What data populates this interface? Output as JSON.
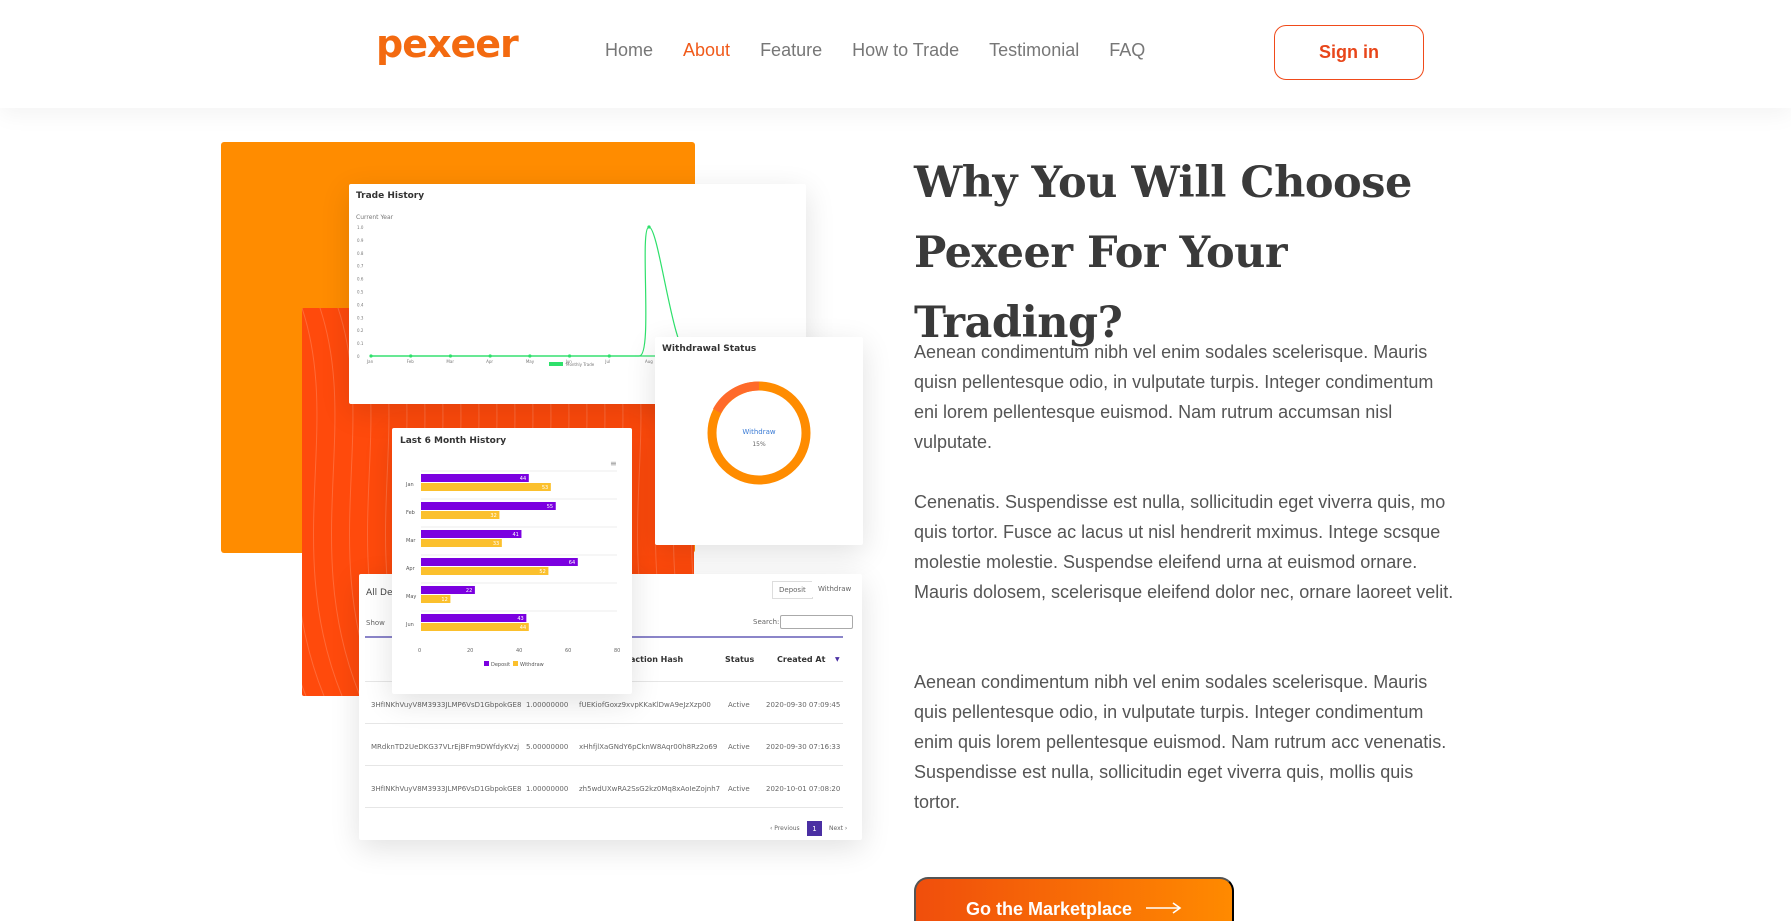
{
  "header": {
    "logo": "pexeer",
    "nav": [
      "Home",
      "About",
      "Feature",
      "How to Trade",
      "Testimonial",
      "FAQ"
    ],
    "active_nav": "About",
    "signin": "Sign in"
  },
  "colors": {
    "brand_orange": "#ff8c00",
    "brand_red": "#ff4a0c",
    "accent_text": "#f05a1a",
    "deposit": "#7b00e0",
    "withdraw": "#fbc02d",
    "chart_line": "#2ee06b"
  },
  "illustration": {
    "trade_history": {
      "title": "Trade History",
      "subtitle": "Current Year",
      "y_ticks": [
        "1.0",
        "0.9",
        "0.8",
        "0.7",
        "0.6",
        "0.5",
        "0.4",
        "0.3",
        "0.2",
        "0.1",
        "0"
      ],
      "x_ticks": [
        "Jan",
        "Feb",
        "Mar",
        "Apr",
        "May",
        "Jun",
        "Jul",
        "Aug"
      ],
      "legend": "Monthly Trade"
    },
    "withdrawal_status": {
      "title": "Withdrawal Status",
      "center_label": "Withdraw",
      "center_value": "15%"
    },
    "last_6_month": {
      "title": "Last 6 Month History",
      "legend": [
        "Deposit",
        "Withdraw"
      ],
      "x_ticks": [
        "0",
        "20",
        "40",
        "60",
        "80"
      ]
    },
    "all_deposits": {
      "title": "All De",
      "tabs": [
        "Deposit",
        "Withdraw"
      ],
      "show_label": "Show",
      "search_label": "Search:",
      "columns": [
        "action Hash",
        "Status",
        "Created At"
      ],
      "rows": [
        {
          "addr": "3HfINKhVuyV8M3933JLMP6VsD1GbpokGE8",
          "amount": "1.00000000",
          "hash": "fUEKiofGoxz9xvpKKaKlDwA9eJzXzp00",
          "status": "Active",
          "created": "2020-09-30 07:09:45"
        },
        {
          "addr": "MRdknTD2UeDKG37VLrEjBFm9DWfdyKVzj",
          "amount": "5.00000000",
          "hash": "xHhfjlXaGNdY6pCknW8Aqr00h8Rz2o69",
          "status": "Active",
          "created": "2020-09-30 07:16:33"
        },
        {
          "addr": "3HfINKhVuyV8M3933JLMP6VsD1GbpokGE8",
          "amount": "1.00000000",
          "hash": "zh5wdUXwRA2SsG2kz0Mq8xAoIeZojnh7",
          "status": "Active",
          "created": "2020-10-01 07:08:20"
        }
      ],
      "pagination": {
        "prev": "‹ Previous",
        "current": "1",
        "next": "Next ›"
      }
    }
  },
  "content": {
    "heading": "Why You Will Choose Pexeer For Your Trading?",
    "paragraphs": [
      "Aenean condimentum nibh vel enim sodales scelerisque. Mauris quisn pellentesque odio, in vulputate turpis. Integer condimentum eni lorem pellentesque euismod. Nam rutrum accumsan nisl vulputate.",
      "Cenenatis. Suspendisse est nulla, sollicitudin eget viverra quis, mo quis tortor. Fusce ac lacus ut nisl hendrerit mximus. Intege scsque molestie molestie. Suspendse eleifend urna at euismod ornare. Mauris dolosem, scelerisque eleifend dolor nec, ornare laoreet velit.",
      "Aenean condimentum nibh vel enim sodales scelerisque. Mauris quis pellentesque odio, in vulputate turpis. Integer condimentum enim quis lorem pellentesque euismod. Nam rutrum acc venenatis. Suspendisse est nulla, sollicitudin eget viverra quis, mollis quis tortor."
    ],
    "cta": "Go the Marketplace"
  },
  "chart_data": [
    {
      "type": "line",
      "title": "Trade History",
      "subtitle": "Current Year",
      "x": [
        "Jan",
        "Feb",
        "Mar",
        "Apr",
        "May",
        "Jun",
        "Jul",
        "Aug"
      ],
      "series": [
        {
          "name": "Monthly Trade",
          "values": [
            0,
            0,
            0,
            0,
            0,
            0,
            0,
            1
          ]
        }
      ],
      "ylim": [
        0,
        1.0
      ]
    },
    {
      "type": "pie",
      "title": "Withdrawal Status",
      "labels": [
        "Withdraw"
      ],
      "values": [
        100
      ]
    },
    {
      "type": "bar",
      "title": "Last 6 Month History",
      "categories": [
        "Jan",
        "Feb",
        "Mar",
        "Apr",
        "May",
        "Jun"
      ],
      "series": [
        {
          "name": "Deposit",
          "values": [
            44,
            55,
            41,
            64,
            22,
            43
          ]
        },
        {
          "name": "Withdraw",
          "values": [
            53,
            32,
            33,
            52,
            12,
            44
          ]
        }
      ],
      "xlim": [
        0,
        80
      ],
      "orientation": "horizontal"
    }
  ]
}
